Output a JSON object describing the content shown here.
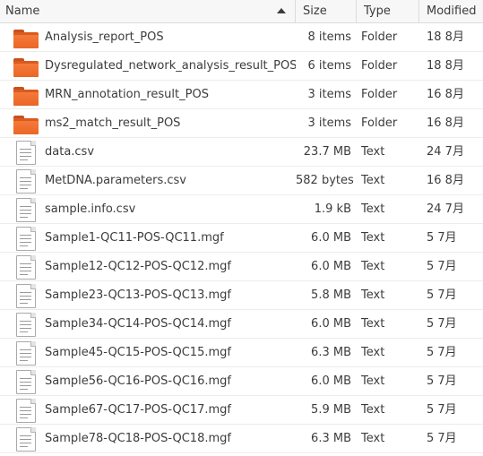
{
  "header": {
    "name": "Name",
    "size": "Size",
    "type": "Type",
    "modified": "Modified"
  },
  "files": [
    {
      "name": "Analysis_report_POS",
      "size": "8 items",
      "type": "Folder",
      "modified": "18 8月",
      "icon": "folder-icon"
    },
    {
      "name": "Dysregulated_network_analysis_result_POS",
      "size": "6 items",
      "type": "Folder",
      "modified": "18 8月",
      "icon": "folder-icon"
    },
    {
      "name": "MRN_annotation_result_POS",
      "size": "3 items",
      "type": "Folder",
      "modified": "16 8月",
      "icon": "folder-icon"
    },
    {
      "name": "ms2_match_result_POS",
      "size": "3 items",
      "type": "Folder",
      "modified": "16 8月",
      "icon": "folder-icon"
    },
    {
      "name": "data.csv",
      "size": "23.7 MB",
      "type": "Text",
      "modified": "24 7月",
      "icon": "text-file-icon"
    },
    {
      "name": "MetDNA.parameters.csv",
      "size": "582 bytes",
      "type": "Text",
      "modified": "16 8月",
      "icon": "text-file-icon"
    },
    {
      "name": "sample.info.csv",
      "size": "1.9 kB",
      "type": "Text",
      "modified": "24 7月",
      "icon": "text-file-icon"
    },
    {
      "name": "Sample1-QC11-POS-QC11.mgf",
      "size": "6.0 MB",
      "type": "Text",
      "modified": "5 7月",
      "icon": "text-file-icon"
    },
    {
      "name": "Sample12-QC12-POS-QC12.mgf",
      "size": "6.0 MB",
      "type": "Text",
      "modified": "5 7月",
      "icon": "text-file-icon"
    },
    {
      "name": "Sample23-QC13-POS-QC13.mgf",
      "size": "5.8 MB",
      "type": "Text",
      "modified": "5 7月",
      "icon": "text-file-icon"
    },
    {
      "name": "Sample34-QC14-POS-QC14.mgf",
      "size": "6.0 MB",
      "type": "Text",
      "modified": "5 7月",
      "icon": "text-file-icon"
    },
    {
      "name": "Sample45-QC15-POS-QC15.mgf",
      "size": "6.3 MB",
      "type": "Text",
      "modified": "5 7月",
      "icon": "text-file-icon"
    },
    {
      "name": "Sample56-QC16-POS-QC16.mgf",
      "size": "6.0 MB",
      "type": "Text",
      "modified": "5 7月",
      "icon": "text-file-icon"
    },
    {
      "name": "Sample67-QC17-POS-QC17.mgf",
      "size": "5.9 MB",
      "type": "Text",
      "modified": "5 7月",
      "icon": "text-file-icon"
    },
    {
      "name": "Sample78-QC18-POS-QC18.mgf",
      "size": "6.3 MB",
      "type": "Text",
      "modified": "5 7月",
      "icon": "text-file-icon"
    }
  ]
}
